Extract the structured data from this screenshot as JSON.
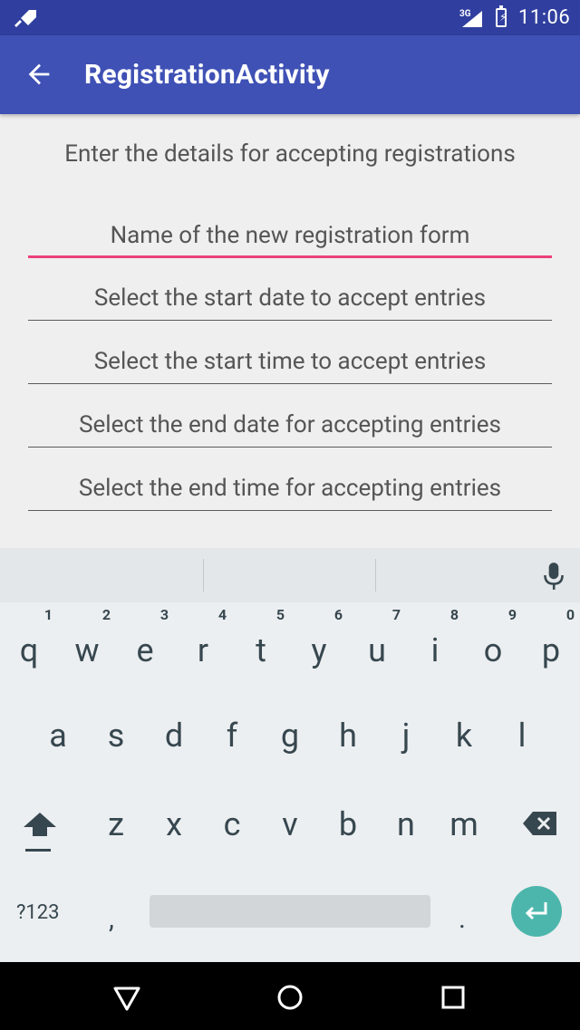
{
  "status_bar": {
    "network": "3G",
    "time": "11:06"
  },
  "app_bar": {
    "title": "RegistrationActivity"
  },
  "intro_text": "Enter the details for accepting registrations",
  "fields": [
    {
      "placeholder": "Name of the new registration form"
    },
    {
      "placeholder": "Select the start date to accept entries"
    },
    {
      "placeholder": "Select the start time to accept entries"
    },
    {
      "placeholder": "Select the end date for accepting entries"
    },
    {
      "placeholder": "Select the end time for accepting entries"
    }
  ],
  "keyboard": {
    "row1": [
      {
        "key": "q",
        "hint": "1"
      },
      {
        "key": "w",
        "hint": "2"
      },
      {
        "key": "e",
        "hint": "3"
      },
      {
        "key": "r",
        "hint": "4"
      },
      {
        "key": "t",
        "hint": "5"
      },
      {
        "key": "y",
        "hint": "6"
      },
      {
        "key": "u",
        "hint": "7"
      },
      {
        "key": "i",
        "hint": "8"
      },
      {
        "key": "o",
        "hint": "9"
      },
      {
        "key": "p",
        "hint": "0"
      }
    ],
    "row2": [
      "a",
      "s",
      "d",
      "f",
      "g",
      "h",
      "j",
      "k",
      "l"
    ],
    "row3": [
      "z",
      "x",
      "c",
      "v",
      "b",
      "n",
      "m"
    ],
    "symbols_label": "?123",
    "comma": ",",
    "period": "."
  },
  "colors": {
    "status_bar": "#303f9f",
    "app_bar": "#3f51b5",
    "focus_underline": "#ec407a",
    "enter_key": "#4db6ac"
  }
}
